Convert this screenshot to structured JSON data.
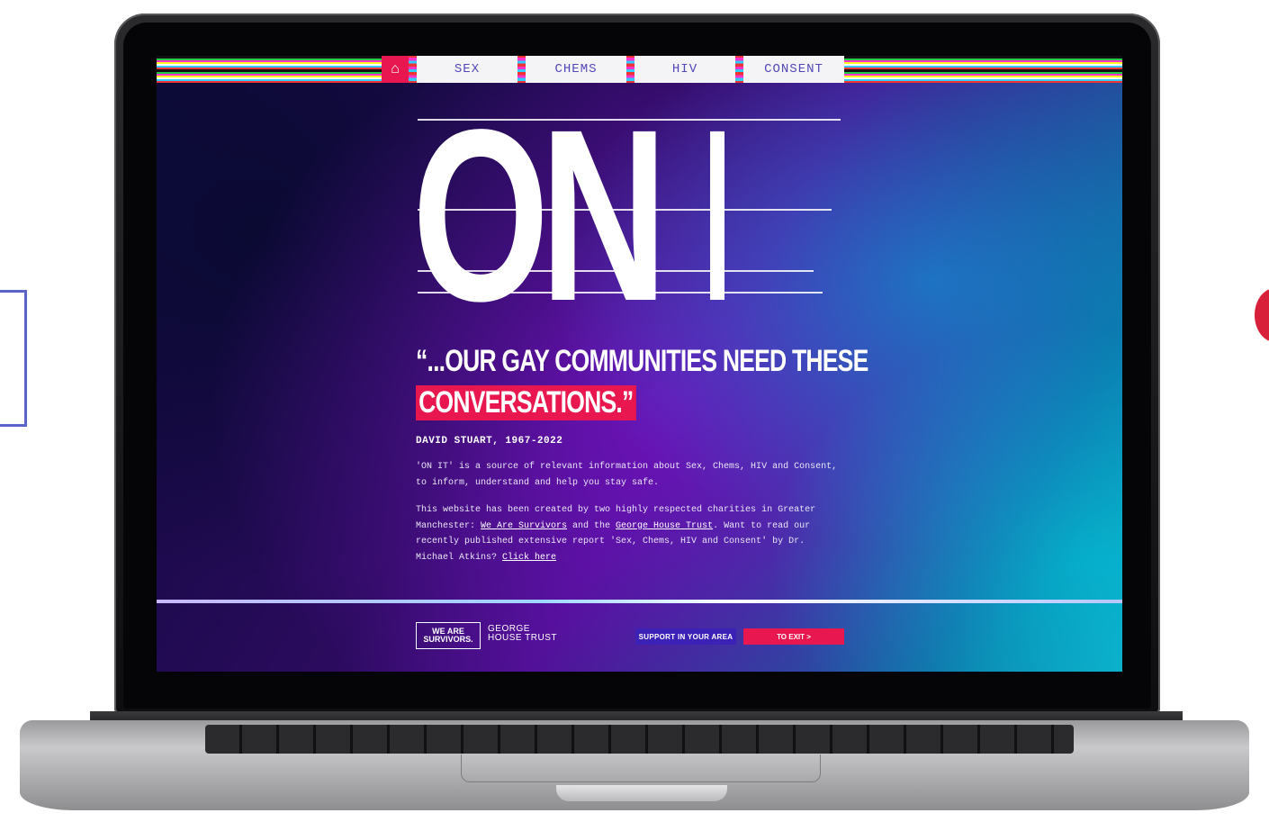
{
  "nav": {
    "home_icon": "home-icon",
    "items": [
      "SEX",
      "CHEMS",
      "HIV",
      "CONSENT"
    ]
  },
  "hero": {
    "logo": "ON IT",
    "quote_line1": "“...OUR GAY COMMUNITIES NEED THESE",
    "quote_line2": "CONVERSATIONS.”",
    "attribution": "DAVID STUART, 1967-2022"
  },
  "intro": {
    "paragraph1": "'ON IT' is a source of relevant information about Sex, Chems, HIV and Consent, to inform, understand and help you stay safe.",
    "p2_before": "This website has been created by two highly respected charities in Greater Manchester: ",
    "link_wearesurvivors": "We Are Survivors",
    "p2_mid": " and the ",
    "link_georgehouse": "George House Trust",
    "p2_after": ". Want to read our recently published extensive report 'Sex, Chems, HIV and Consent' by Dr. Michael Atkins? ",
    "link_clickhere": "Click here"
  },
  "footer": {
    "logo_wearesurvivors": "WE ARE SURVIVORS.",
    "logo_georgehouse": "GEORGE HOUSE TRUST",
    "support_button": "SUPPORT IN YOUR AREA",
    "exit_button": "TO EXIT >"
  },
  "colors": {
    "accent_pink": "#e8174f",
    "accent_purple": "#3b21b5",
    "nav_text": "#5248b8"
  }
}
